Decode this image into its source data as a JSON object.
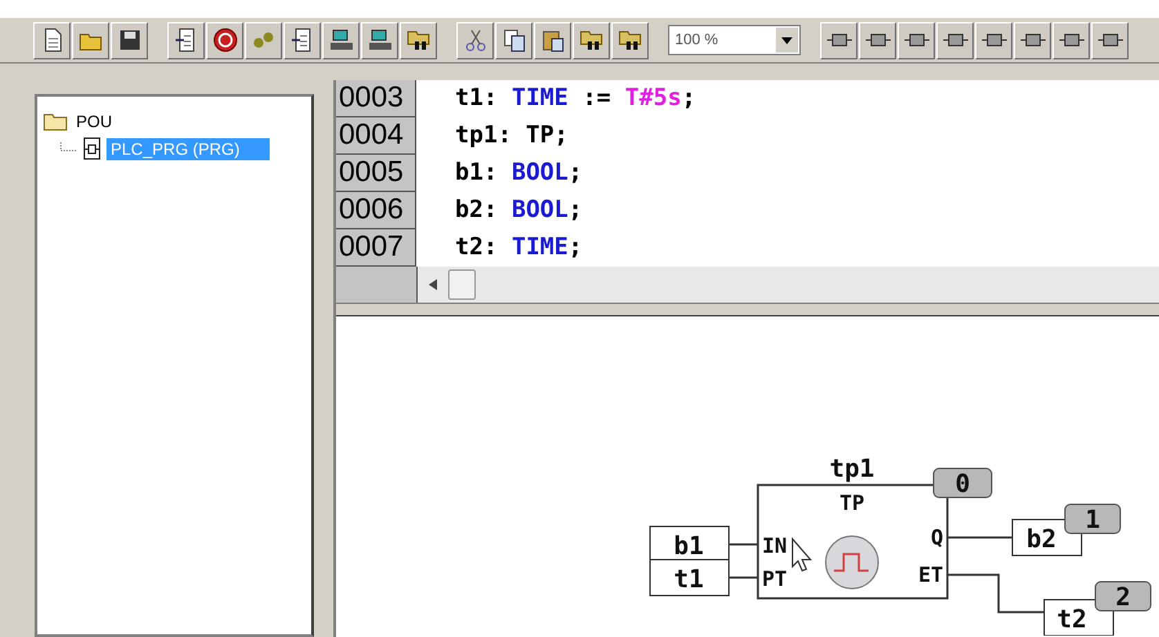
{
  "toolbar": {
    "zoom": "100 %"
  },
  "tree": {
    "root": {
      "label": "POU",
      "expanded": true,
      "children": [
        {
          "label": "PLC_PRG (PRG)",
          "selected": true
        }
      ]
    }
  },
  "editor": {
    "lines": [
      {
        "number": "0003",
        "tokens": [
          {
            "kind": "plain",
            "text": "t1: "
          },
          {
            "kind": "keyword",
            "text": "TIME"
          },
          {
            "kind": "plain",
            "text": " := "
          },
          {
            "kind": "literal",
            "text": "T#5s"
          },
          {
            "kind": "plain",
            "text": ";"
          }
        ]
      },
      {
        "number": "0004",
        "tokens": [
          {
            "kind": "plain",
            "text": "tp1: TP;"
          }
        ]
      },
      {
        "number": "0005",
        "tokens": [
          {
            "kind": "plain",
            "text": "b1: "
          },
          {
            "kind": "keyword",
            "text": "BOOL"
          },
          {
            "kind": "plain",
            "text": ";"
          }
        ]
      },
      {
        "number": "0006",
        "tokens": [
          {
            "kind": "plain",
            "text": "b2: "
          },
          {
            "kind": "keyword",
            "text": "BOOL"
          },
          {
            "kind": "plain",
            "text": ";"
          }
        ]
      },
      {
        "number": "0007",
        "tokens": [
          {
            "kind": "plain",
            "text": "t2: "
          },
          {
            "kind": "keyword",
            "text": "TIME"
          },
          {
            "kind": "plain",
            "text": ";"
          }
        ]
      }
    ]
  },
  "diagram": {
    "block": {
      "instance": "tp1",
      "type": "TP",
      "order": "0"
    },
    "inputs": [
      {
        "pin": "IN",
        "variable": "b1"
      },
      {
        "pin": "PT",
        "variable": "t1"
      }
    ],
    "outputs": [
      {
        "pin": "Q",
        "variable": "b2",
        "order": "1"
      },
      {
        "pin": "ET",
        "variable": "t2",
        "order": "2"
      }
    ]
  }
}
